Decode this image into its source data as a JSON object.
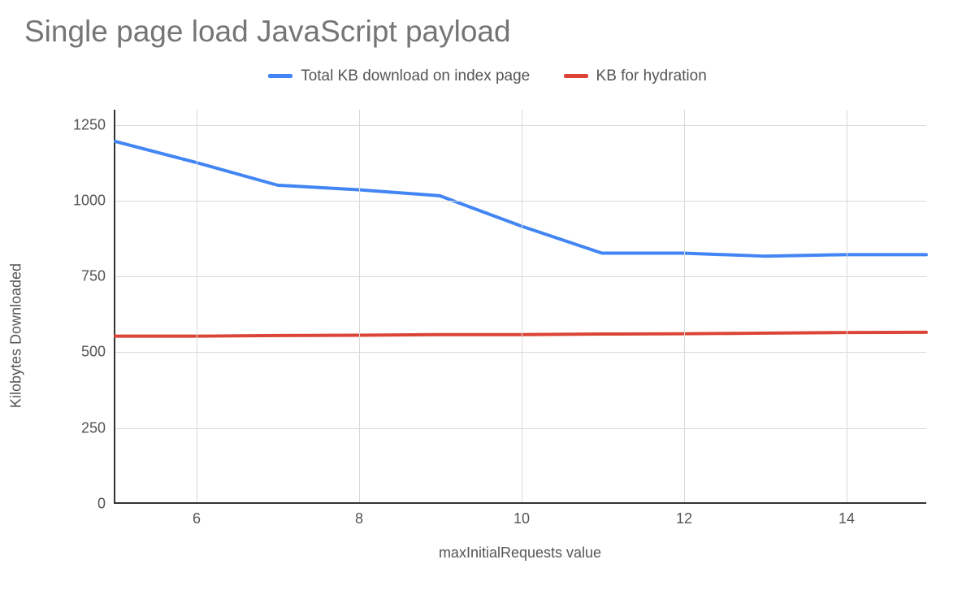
{
  "title": "Single page load JavaScript payload",
  "legend": {
    "items": [
      {
        "label": "Total KB download on index page",
        "color": "#4285f4"
      },
      {
        "label": "KB for hydration",
        "color": "#db4437"
      }
    ]
  },
  "xlabel": "maxInitialRequests value",
  "ylabel": "Kilobytes Downloaded",
  "chart_data": {
    "type": "line",
    "xlabel": "maxInitialRequests value",
    "ylabel": "Kilobytes Downloaded",
    "title": "Single page load JavaScript payload",
    "x": [
      5,
      6,
      7,
      8,
      9,
      10,
      11,
      12,
      13,
      14,
      15
    ],
    "x_ticks": [
      6,
      8,
      10,
      12,
      14
    ],
    "y_ticks": [
      0,
      250,
      500,
      750,
      1000,
      1250
    ],
    "xlim": [
      5,
      15
    ],
    "ylim": [
      0,
      1300
    ],
    "series": [
      {
        "name": "Total KB download on index page",
        "color": "#4285f4",
        "values": [
          1195,
          1125,
          1050,
          1035,
          1015,
          915,
          825,
          825,
          815,
          820,
          820
        ]
      },
      {
        "name": "KB for hydration",
        "color": "#db4437",
        "values": [
          550,
          550,
          552,
          553,
          555,
          555,
          557,
          558,
          560,
          562,
          563
        ]
      }
    ]
  }
}
